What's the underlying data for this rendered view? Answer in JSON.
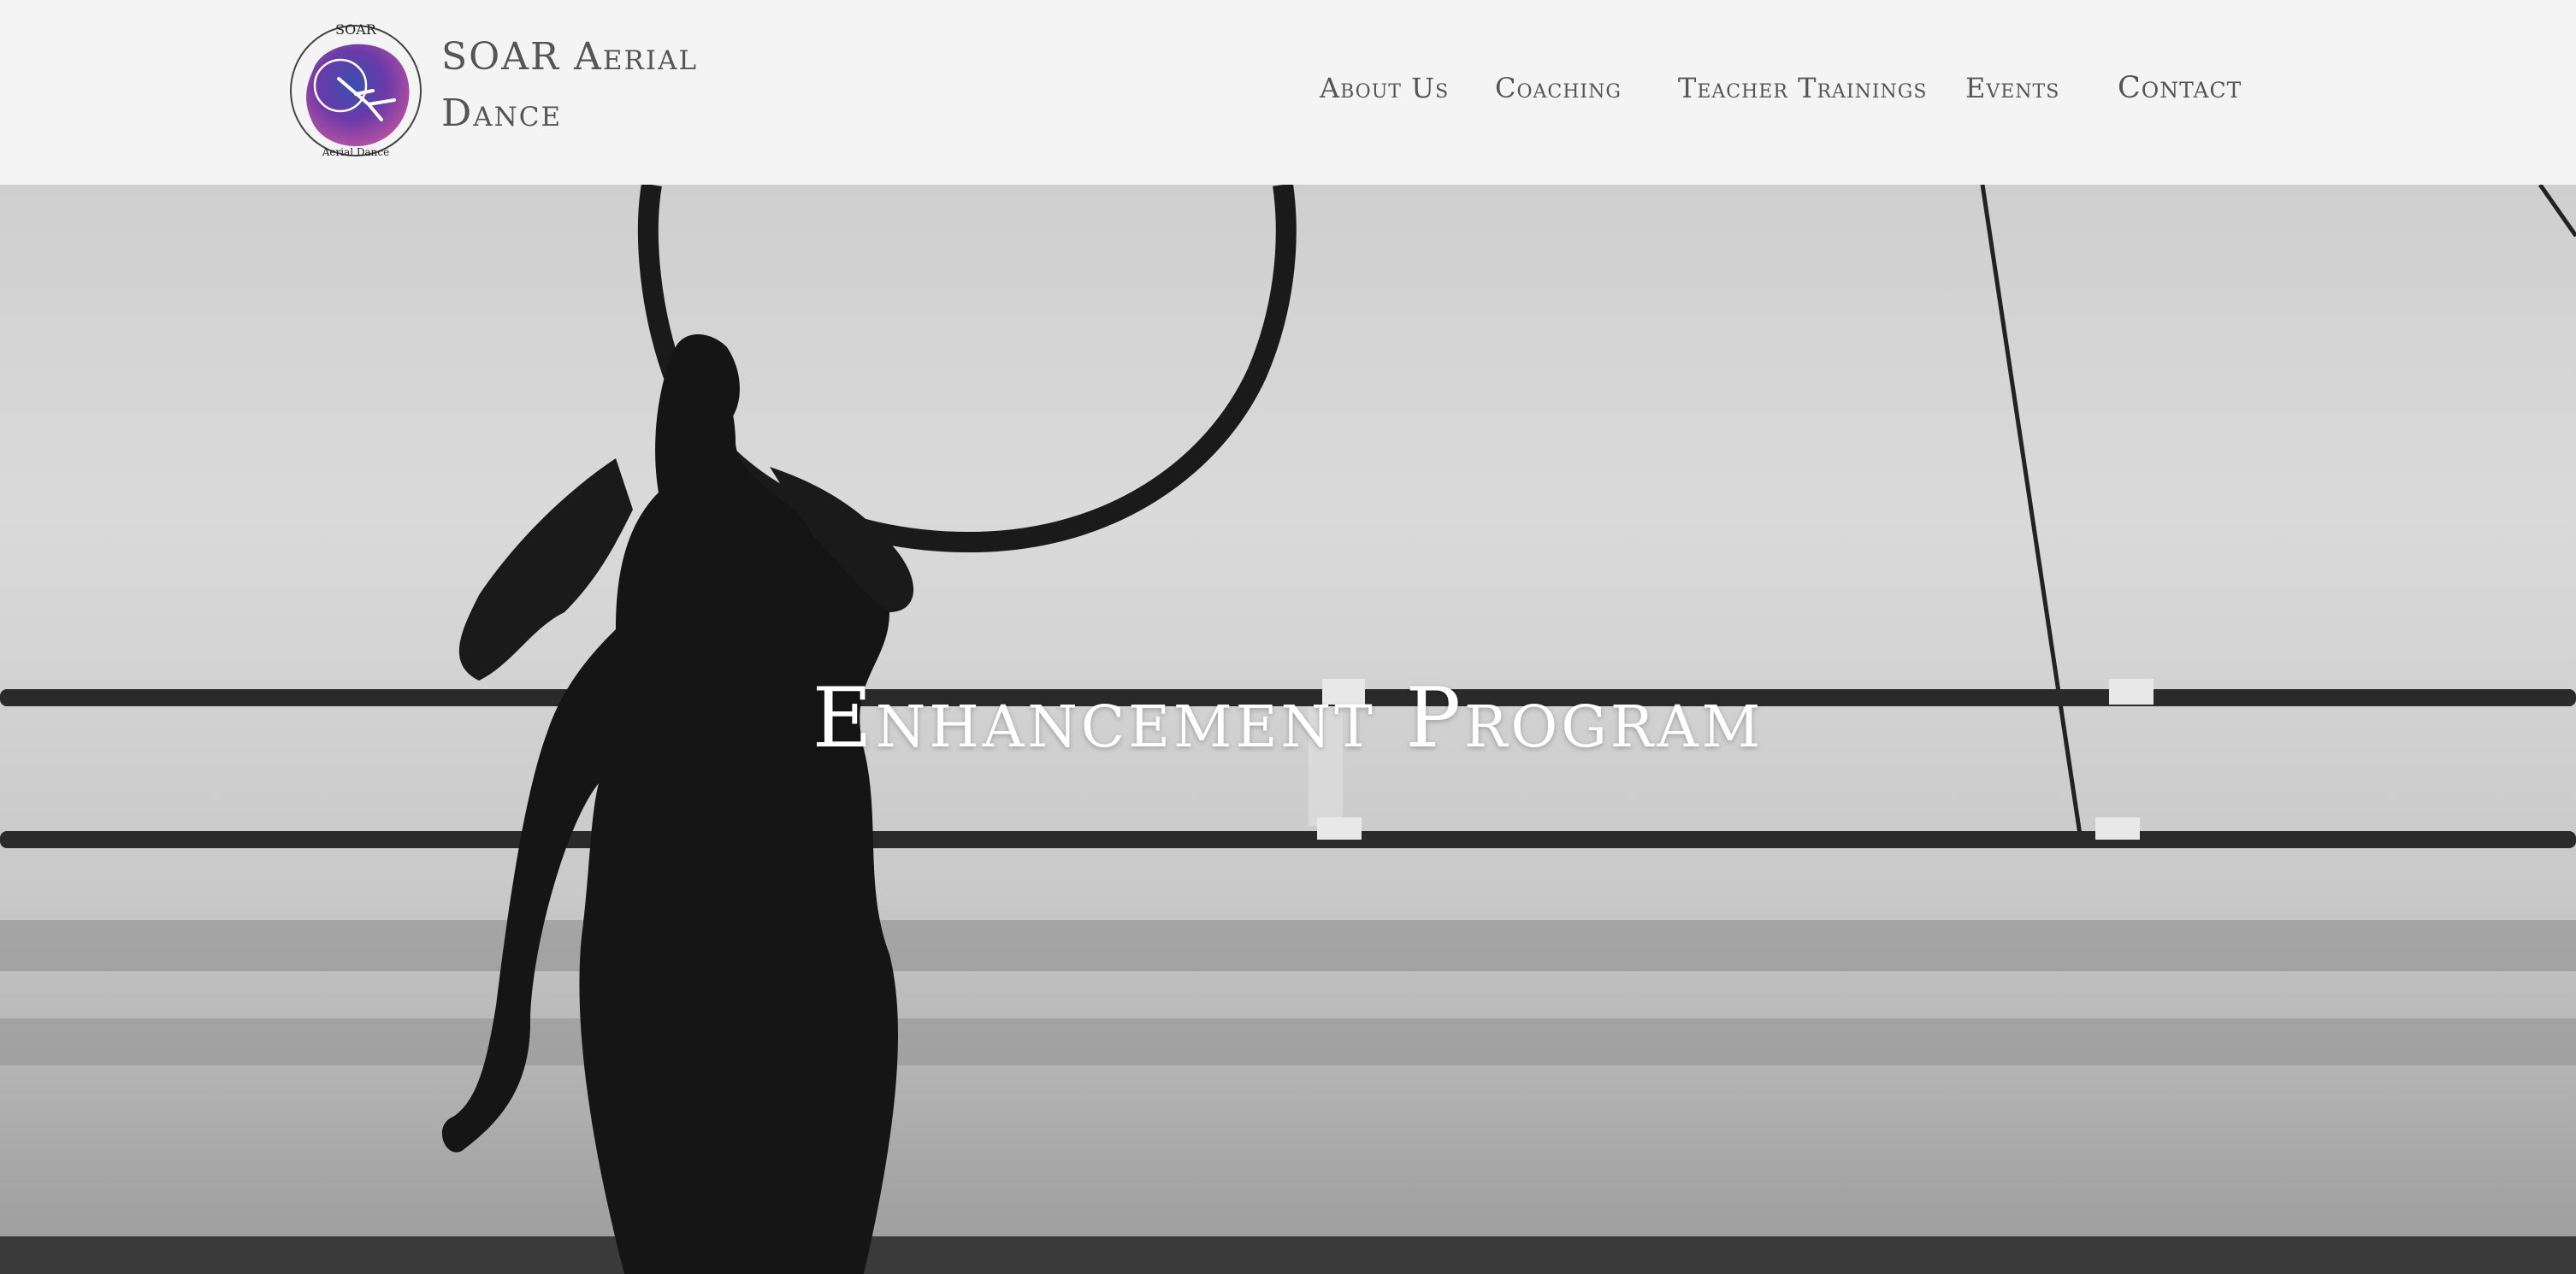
{
  "site": {
    "name_line1": "SOAR Aerial",
    "name_line2": "Dance",
    "logo": {
      "top_text": "SOAR",
      "bottom_text": "Aerial Dance",
      "colors": [
        "#2e3f8f",
        "#6a3aa8",
        "#b04fa3"
      ]
    }
  },
  "nav": {
    "items": [
      {
        "label": "About Us"
      },
      {
        "label": "Coaching"
      },
      {
        "label": "Teacher Trainings"
      },
      {
        "label": "Events"
      },
      {
        "label": "Contact"
      }
    ]
  },
  "hero": {
    "title": "Enhancement Program",
    "image": "black-and-white photo of aerialist with hoop in studio with ballet barres"
  },
  "colors": {
    "header_bg": "#f4f4f4",
    "text": "#555555",
    "hero_text": "#ffffff"
  }
}
